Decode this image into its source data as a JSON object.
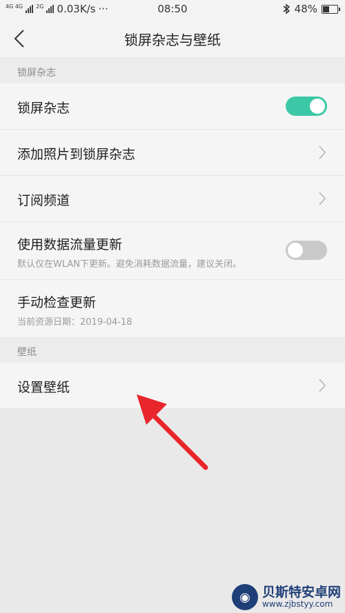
{
  "status_bar": {
    "net_tag_1": "4G 4G",
    "net_tag_2": "2G",
    "speed": "0.03K/s",
    "dots": "···",
    "time": "08:50",
    "battery": "48%",
    "battery_level": 0.48
  },
  "header": {
    "title": "锁屏杂志与壁纸"
  },
  "section_lock": {
    "heading": "锁屏杂志",
    "rows": [
      {
        "title": "锁屏杂志",
        "toggle": true
      },
      {
        "title": "添加照片到锁屏杂志"
      },
      {
        "title": "订阅频道"
      },
      {
        "title": "使用数据流量更新",
        "subtitle": "默认仅在WLAN下更新。避免消耗数据流量，建议关闭。",
        "toggle": false
      },
      {
        "title": "手动检查更新",
        "subtitle": "当前资源日期：2019-04-18"
      }
    ]
  },
  "section_wallpaper": {
    "heading": "壁纸",
    "rows": [
      {
        "title": "设置壁纸"
      }
    ]
  },
  "annotation": {
    "arrow_color": "#e8262b"
  },
  "watermark": {
    "brand": "贝斯特安卓网",
    "url": "www.zjbstyy.com"
  },
  "colors": {
    "accent": "#3cc8a6",
    "background": "#e9e9e9"
  }
}
